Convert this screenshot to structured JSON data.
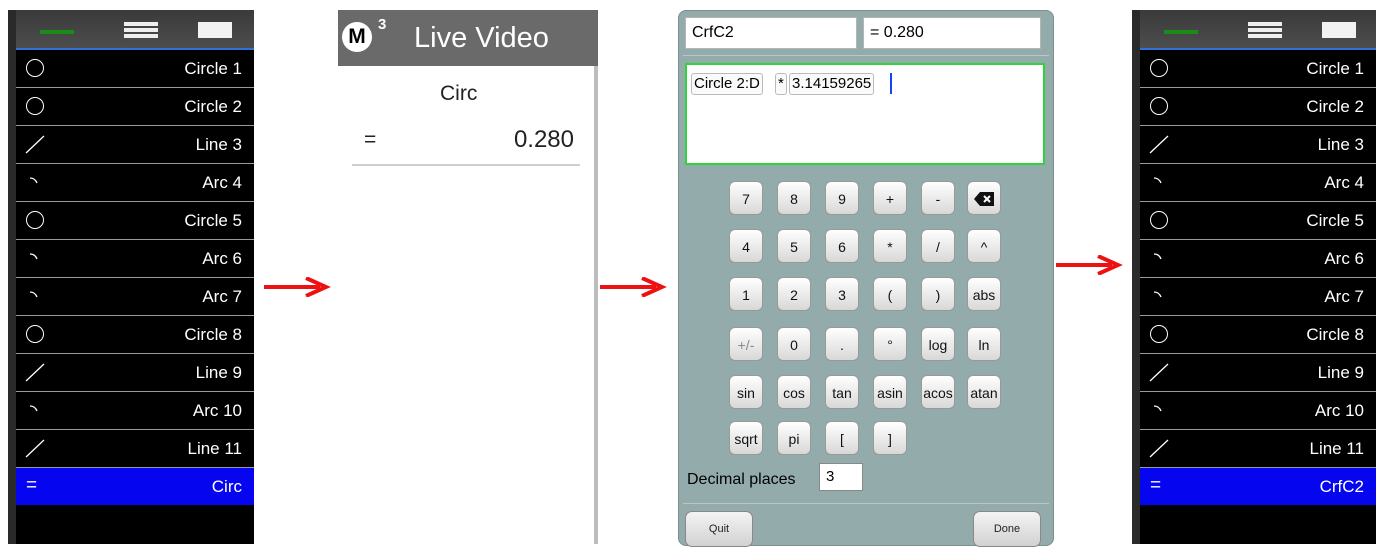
{
  "panel_before": {
    "items": [
      {
        "type": "circle",
        "label": "Circle 1"
      },
      {
        "type": "circle",
        "label": "Circle 2"
      },
      {
        "type": "line",
        "label": "Line 3"
      },
      {
        "type": "arc",
        "label": "Arc 4"
      },
      {
        "type": "circle",
        "label": "Circle 5"
      },
      {
        "type": "arc",
        "label": "Arc 6"
      },
      {
        "type": "arc",
        "label": "Arc 7"
      },
      {
        "type": "circle",
        "label": "Circle 8"
      },
      {
        "type": "line",
        "label": "Line 9"
      },
      {
        "type": "arc",
        "label": "Arc 10"
      },
      {
        "type": "line",
        "label": "Line 11"
      }
    ],
    "selected": {
      "symbol": "=",
      "label": "Circ"
    }
  },
  "live_video": {
    "badge": "M",
    "superscript": "3",
    "title": "Live Video",
    "feature_name": "Circ",
    "equals": "=",
    "value": "0.280"
  },
  "calculator": {
    "name_field": "CrfC2",
    "result_field": "= 0.280",
    "expression": {
      "token1": "Circle 2:D",
      "op": "*",
      "token2": "3.14159265"
    },
    "keys": [
      [
        "7",
        "8",
        "9",
        "+",
        "-",
        "⌫"
      ],
      [
        "4",
        "5",
        "6",
        "*",
        "/",
        "^"
      ],
      [
        "1",
        "2",
        "3",
        "(",
        ")",
        "abs"
      ],
      [
        "+/-",
        "0",
        ".",
        "°",
        "log",
        "ln"
      ],
      [
        "sin",
        "cos",
        "tan",
        "asin",
        "acos",
        "atan"
      ],
      [
        "sqrt",
        "pi",
        "[",
        "]"
      ]
    ],
    "decimal_label": "Decimal places",
    "decimal_value": "3",
    "quit_label": "Quit",
    "done_label": "Done"
  },
  "panel_after": {
    "items": [
      {
        "type": "circle",
        "label": "Circle 1"
      },
      {
        "type": "circle",
        "label": "Circle 2"
      },
      {
        "type": "line",
        "label": "Line 3"
      },
      {
        "type": "arc",
        "label": "Arc 4"
      },
      {
        "type": "circle",
        "label": "Circle 5"
      },
      {
        "type": "arc",
        "label": "Arc 6"
      },
      {
        "type": "arc",
        "label": "Arc 7"
      },
      {
        "type": "circle",
        "label": "Circle 8"
      },
      {
        "type": "line",
        "label": "Line 9"
      },
      {
        "type": "arc",
        "label": "Arc 10"
      },
      {
        "type": "line",
        "label": "Line 11"
      }
    ],
    "selected": {
      "symbol": "=",
      "label": "CrfC2"
    }
  },
  "colors": {
    "arrow": "#ee1111",
    "selection": "#0505f0",
    "calc_bg": "#94abab",
    "expr_border": "#2fd43a"
  },
  "icons": {
    "circle": "circle-icon",
    "line": "line-icon",
    "arc": "arc-icon",
    "backspace": "backspace-icon",
    "arrow": "right-arrow-icon"
  }
}
